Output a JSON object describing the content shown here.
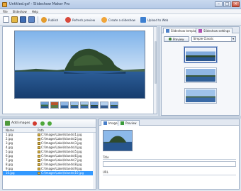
{
  "window": {
    "title": "Untitled.gsf - Slideshow Maker Pro",
    "min": "–",
    "max": "□",
    "close": "×"
  },
  "menu": [
    "File",
    "Slideshow",
    "Help"
  ],
  "toolbar": {
    "publish_label": "Publish",
    "refresh_label": "Refresh preview",
    "create_label": "Create a slideshow",
    "upload_label": "Upload to Web"
  },
  "right_panel": {
    "tab_templates": "Slideshow templates",
    "tab_settings": "Slideshow settings",
    "preview_button": "Preview",
    "select_value": "Simple Classic"
  },
  "image_list": {
    "add_label": "Add images",
    "col_name": "Name",
    "col_path": "Path",
    "rows": [
      {
        "name": "1.jpg",
        "path": "C:\\Images\\Lake\\Islands\\1.jpg"
      },
      {
        "name": "2.jpg",
        "path": "C:\\Images\\Lake\\Islands\\2.jpg"
      },
      {
        "name": "3.jpg",
        "path": "C:\\Images\\Lake\\Islands\\3.jpg"
      },
      {
        "name": "4.jpg",
        "path": "C:\\Images\\Lake\\Islands\\4.jpg"
      },
      {
        "name": "5.jpg",
        "path": "C:\\Images\\Lake\\Islands\\5.jpg"
      },
      {
        "name": "6.jpg",
        "path": "C:\\Images\\Lake\\Islands\\6.jpg"
      },
      {
        "name": "7.jpg",
        "path": "C:\\Images\\Lake\\Islands\\7.jpg"
      },
      {
        "name": "8.jpg",
        "path": "C:\\Images\\Lake\\Islands\\8.jpg"
      },
      {
        "name": "9.jpg",
        "path": "C:\\Images\\Lake\\Islands\\9.jpg"
      },
      {
        "name": "10.jpg",
        "path": "C:\\Images\\Lake\\Islands\\10.jpg"
      }
    ]
  },
  "properties": {
    "tab_image": "Image",
    "tab_preview": "Preview",
    "label_title": "Title",
    "label_url": "URL"
  },
  "colors": {
    "selection": "#3399ff",
    "accent": "#3b62a8",
    "panel_border": "#9fb0c7"
  }
}
